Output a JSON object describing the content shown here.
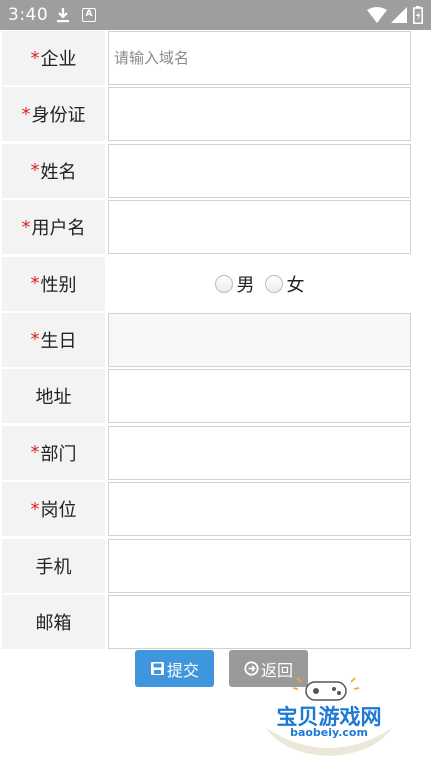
{
  "status_bar": {
    "time": "3:40",
    "icons": [
      "download-icon",
      "a-box-icon",
      "wifi-icon",
      "signal-icon",
      "battery-icon"
    ]
  },
  "form": {
    "rows": [
      {
        "label": "企业",
        "required": true,
        "type": "text",
        "value": "",
        "placeholder": "请输入域名"
      },
      {
        "label": "身份证",
        "required": true,
        "type": "text",
        "value": "",
        "placeholder": ""
      },
      {
        "label": "姓名",
        "required": true,
        "type": "text",
        "value": "",
        "placeholder": ""
      },
      {
        "label": "用户名",
        "required": true,
        "type": "text",
        "value": "",
        "placeholder": ""
      },
      {
        "label": "性别",
        "required": true,
        "type": "radio",
        "options": [
          "男",
          "女"
        ]
      },
      {
        "label": "生日",
        "required": true,
        "type": "date",
        "value": "",
        "placeholder": ""
      },
      {
        "label": "地址",
        "required": false,
        "type": "text",
        "value": "",
        "placeholder": ""
      },
      {
        "label": "部门",
        "required": true,
        "type": "text",
        "value": "",
        "placeholder": ""
      },
      {
        "label": "岗位",
        "required": true,
        "type": "text",
        "value": "",
        "placeholder": ""
      },
      {
        "label": "手机",
        "required": false,
        "type": "text",
        "value": "",
        "placeholder": ""
      },
      {
        "label": "邮箱",
        "required": false,
        "type": "text",
        "value": "",
        "placeholder": ""
      }
    ],
    "required_mark": "*"
  },
  "actions": {
    "submit_label": "提交",
    "back_label": "返回"
  },
  "watermark": {
    "name": "宝贝游戏网",
    "url": "baobeiy.com"
  },
  "colors": {
    "status_bar": "#9e9e9e",
    "label_bg": "#f3f3f3",
    "required": "#e02020",
    "submit": "#3f96dc",
    "back": "#9a9a9a",
    "watermark": "#1e78d6"
  }
}
